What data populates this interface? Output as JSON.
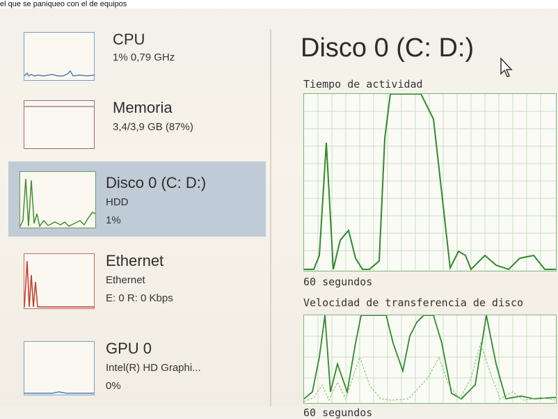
{
  "caption": "el que se paniqueo con el de equipos",
  "sidebar": {
    "items": [
      {
        "title": "CPU",
        "line1": "1% 0,79 GHz",
        "line2": "",
        "color": "#5a8fc0"
      },
      {
        "title": "Memoria",
        "line1": "3,4/3,9 GB (87%)",
        "line2": "",
        "color": "#9b4a6a"
      },
      {
        "title": "Disco 0 (C: D:)",
        "line1": "HDD",
        "line2": "1%",
        "color": "#4a9a3a"
      },
      {
        "title": "Ethernet",
        "line1": "Ethernet",
        "line2": "E: 0 R: 0 Kbps",
        "color": "#c04a2a"
      },
      {
        "title": "GPU 0",
        "line1": "Intel(R) HD Graphi...",
        "line2": "0%",
        "color": "#5a8fc0"
      }
    ]
  },
  "detail": {
    "title": "Disco 0 (C: D:)",
    "graph1_label": "Tiempo de actividad",
    "graph1_time": "60 segundos",
    "graph2_label": "Velocidad de transferencia de disco",
    "graph2_time": "60 segundos"
  }
}
